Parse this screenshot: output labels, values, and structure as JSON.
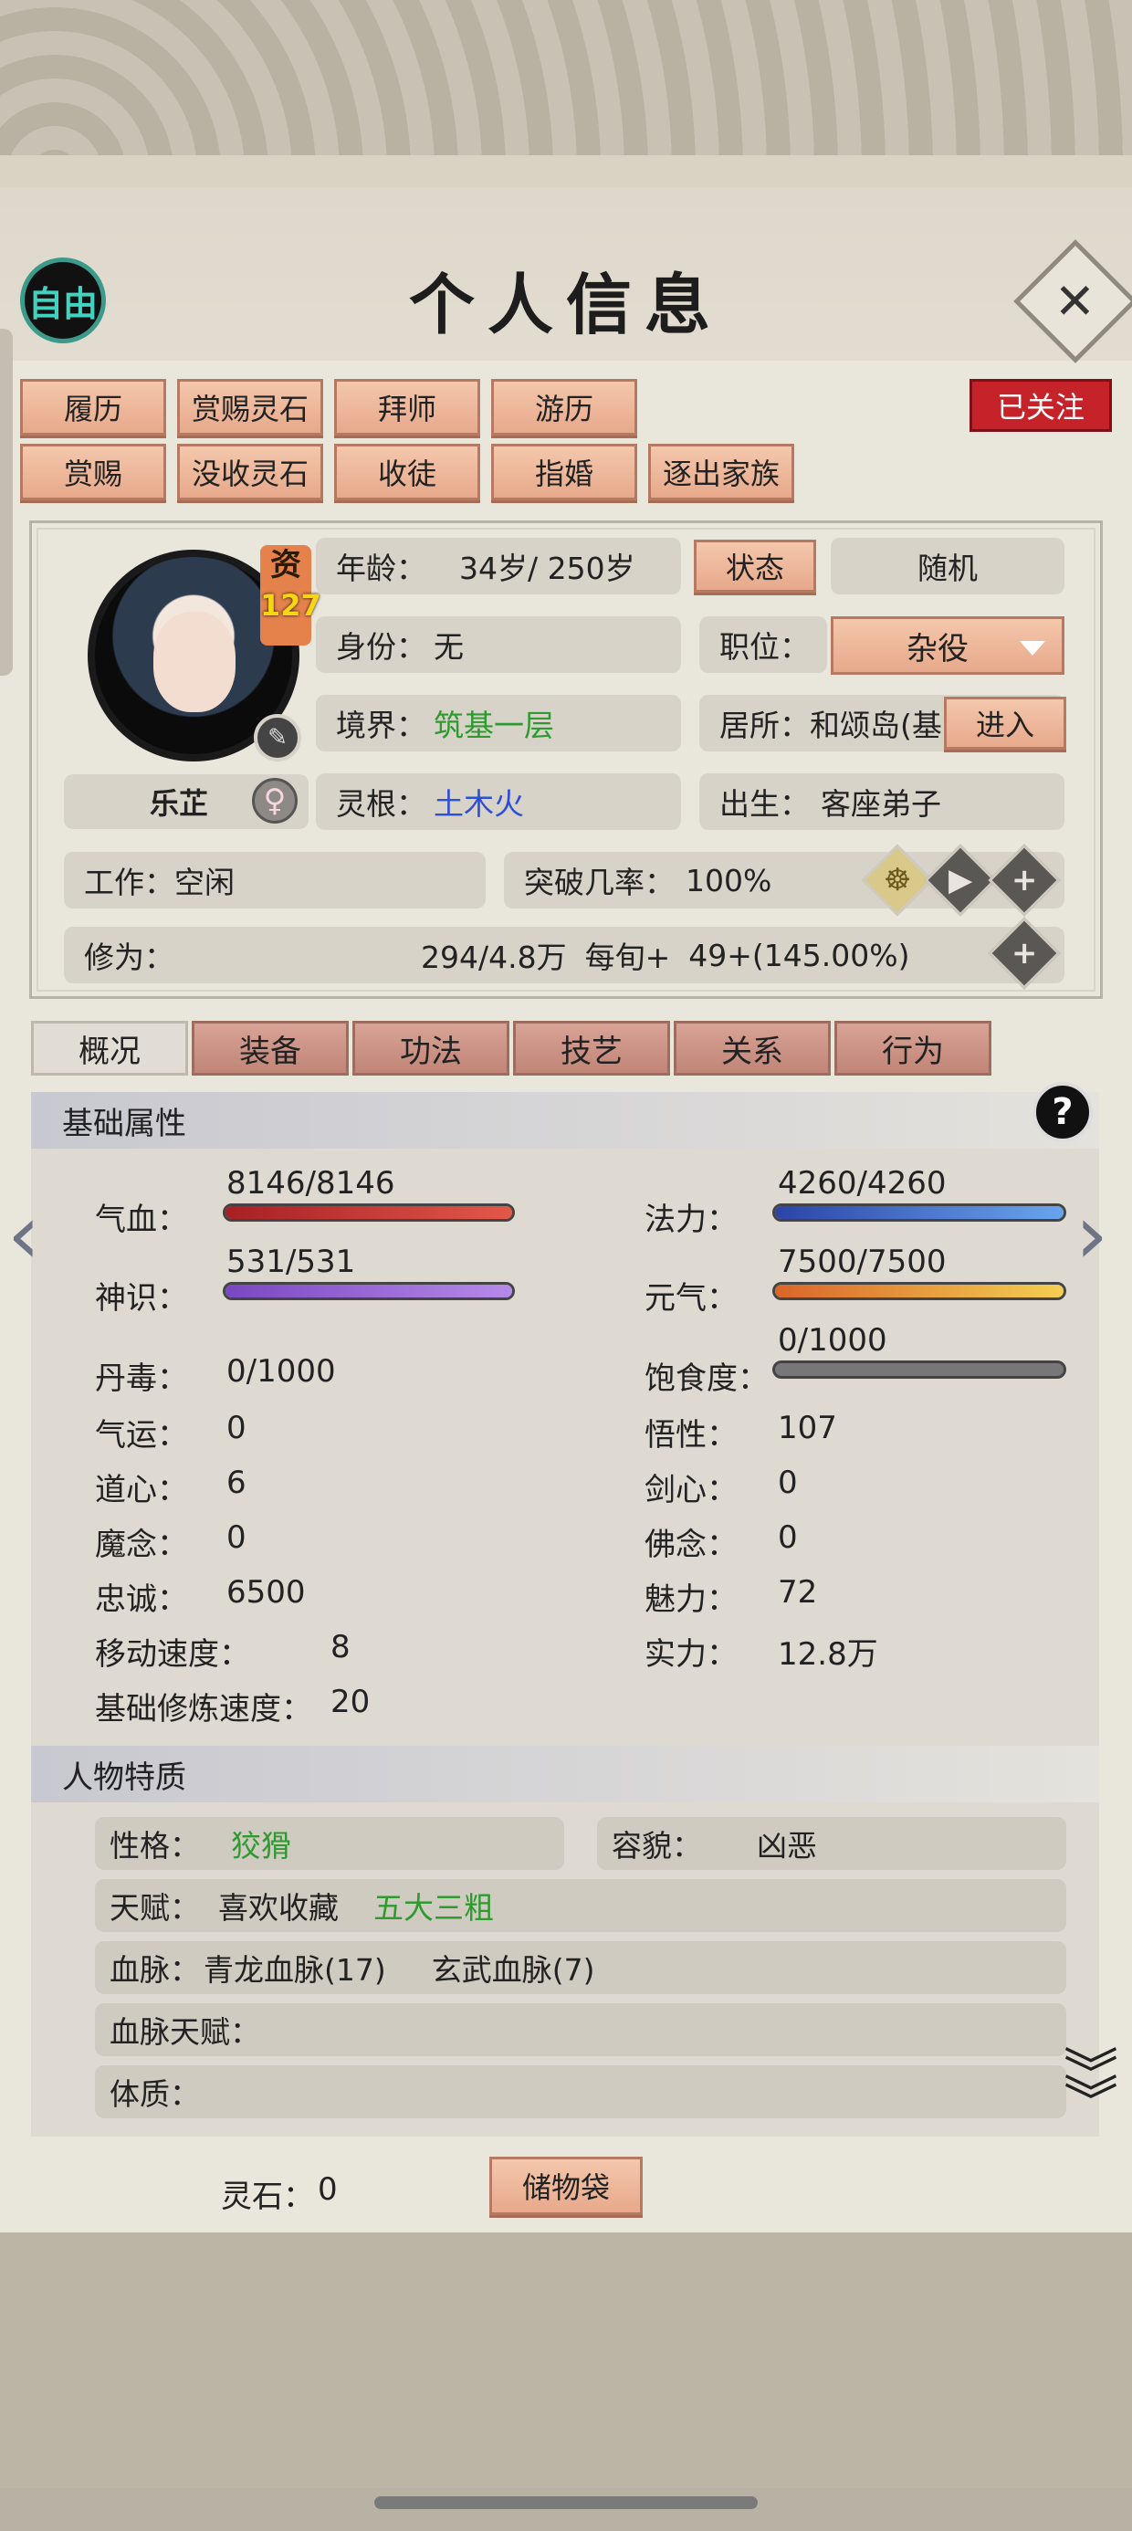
{
  "header": {
    "title": "个人信息",
    "free_label": "自由",
    "close_icon": "close-icon"
  },
  "follow_label": "已关注",
  "actions_row1": [
    "履历",
    "赏赐灵石",
    "拜师",
    "游历"
  ],
  "actions_row2": [
    "赏赐",
    "没收灵石",
    "收徒",
    "指婚",
    "逐出家族"
  ],
  "character": {
    "aptitude_label": "资",
    "aptitude_value": "127",
    "name": "乐芷",
    "age_label": "年龄：",
    "age_value": "34岁/ 250岁",
    "status_btn": "状态",
    "random_btn": "随机",
    "identity_label": "身份：",
    "identity_value": "无",
    "position_label": "职位：",
    "position_value": "杂役",
    "realm_label": "境界：",
    "realm_value": "筑基一层",
    "residence_label": "居所：",
    "residence_value": "和颂岛(基",
    "enter_btn": "进入",
    "root_label": "灵根：",
    "root_value": "土木火",
    "origin_label": "出生：",
    "origin_value": "客座弟子",
    "work_label": "工作：",
    "work_value": "空闲",
    "breakthrough_label": "突破几率：",
    "breakthrough_value": "100%",
    "cultivation_label": "修为：",
    "cultivation_value": "294/4.8万",
    "per_period_label": "每旬+",
    "per_period_value": "49+(145.00%)"
  },
  "tabs": [
    "概况",
    "装备",
    "功法",
    "技艺",
    "关系",
    "行为"
  ],
  "basic": {
    "title": "基础属性",
    "hp_label": "气血：",
    "hp_value": "8146/8146",
    "hp_ratio": 1.0,
    "mana_label": "法力：",
    "mana_value": "4260/4260",
    "mana_ratio": 1.0,
    "spirit_label": "神识：",
    "spirit_value": "531/531",
    "spirit_ratio": 1.0,
    "vigor_label": "元气：",
    "vigor_value": "7500/7500",
    "vigor_ratio": 1.0,
    "poison_label": "丹毒：",
    "poison_value": "0/1000",
    "satiety_label": "饱食度：",
    "satiety_value": "0/1000",
    "satiety_ratio": 0,
    "luck_label": "气运：",
    "luck_value": "0",
    "insight_label": "悟性：",
    "insight_value": "107",
    "dao_label": "道心：",
    "dao_value": "6",
    "sword_label": "剑心：",
    "sword_value": "0",
    "demon_label": "魔念：",
    "demon_value": "0",
    "buddha_label": "佛念：",
    "buddha_value": "0",
    "loyalty_label": "忠诚：",
    "loyalty_value": "6500",
    "charm_label": "魅力：",
    "charm_value": "72",
    "speed_label": "移动速度：",
    "speed_value": "8",
    "power_label": "实力：",
    "power_value": "12.8万",
    "train_label": "基础修炼速度：",
    "train_value": "20"
  },
  "traits": {
    "title": "人物特质",
    "personality_label": "性格：",
    "personality_value": "狡猾",
    "looks_label": "容貌：",
    "looks_value": "凶恶",
    "talent_label": "天赋：",
    "talent_1": "喜欢收藏",
    "talent_2": "五大三粗",
    "bloodline_label": "血脉：",
    "bloodline_1": "青龙血脉(17)",
    "bloodline_2": "玄武血脉(7)",
    "blood_talent_label": "血脉天赋：",
    "physique_label": "体质："
  },
  "footer": {
    "stones_label": "灵石：",
    "stones_value": "0",
    "bag_btn": "储物袋"
  },
  "colors": {
    "hp": "#c23a36",
    "mana": "#4a78d8",
    "spirit": "#9a66d6",
    "vigor": "#e7882e",
    "green_text": "#2f9a2f",
    "blue_text": "#2d4fd6",
    "follow": "#c6222a"
  }
}
